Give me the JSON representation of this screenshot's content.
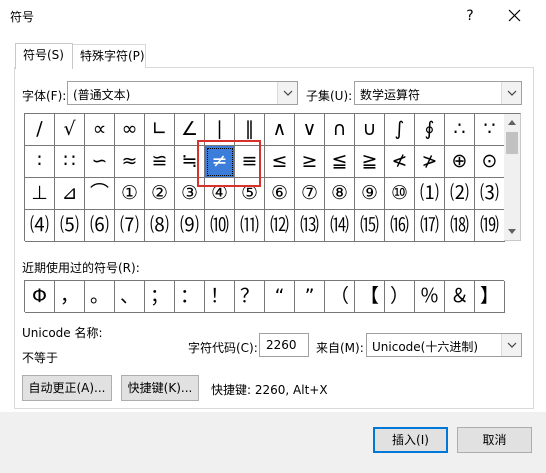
{
  "window": {
    "title": "符号",
    "help_label": "?"
  },
  "tabs": [
    {
      "label": "符号(S)",
      "active": true
    },
    {
      "label": "特殊字符(P)",
      "active": false
    }
  ],
  "font": {
    "label": "字体(F):",
    "value": "(普通文本)"
  },
  "subset": {
    "label": "子集(U):",
    "value": "数学运算符"
  },
  "symbol_rows": [
    [
      "∕",
      "√",
      "∝",
      "∞",
      "∟",
      "∠",
      "∣",
      "∥",
      "∧",
      "∨",
      "∩",
      "∪",
      "∫",
      "∮",
      "∴",
      "∵"
    ],
    [
      "∶",
      "∷",
      "∽",
      "≈",
      "≌",
      "≒",
      "≠",
      "≡",
      "≤",
      "≥",
      "≦",
      "≧",
      "≮",
      "≯",
      "⊕",
      "⊙"
    ],
    [
      "⊥",
      "⊿",
      "⌒",
      "①",
      "②",
      "③",
      "④",
      "⑤",
      "⑥",
      "⑦",
      "⑧",
      "⑨",
      "⑩",
      "⑴",
      "⑵",
      "⑶"
    ],
    [
      "⑷",
      "⑸",
      "⑹",
      "⑺",
      "⑻",
      "⑼",
      "⑽",
      "⑾",
      "⑿",
      "⒀",
      "⒁",
      "⒂",
      "⒃",
      "⒄",
      "⒅",
      "⒆"
    ]
  ],
  "selected": {
    "row": 1,
    "col": 6
  },
  "recent": {
    "label": "近期使用过的符号(R):",
    "symbols": [
      "Φ",
      "，",
      "。",
      "、",
      "；",
      "：",
      "！",
      "？",
      "“",
      "”",
      "（",
      "【",
      "）",
      "％",
      "＆",
      "】"
    ]
  },
  "unicode": {
    "name_label": "Unicode 名称:",
    "name_value": "不等于"
  },
  "char_code": {
    "label": "字符代码(C):",
    "value": "2260"
  },
  "from": {
    "label": "来自(M):",
    "value": "Unicode(十六进制)"
  },
  "buttons": {
    "autocorrect": "自动更正(A)...",
    "shortcut": "快捷键(K)...",
    "shortcut_info": "快捷键: 2260, Alt+X",
    "insert": "插入(I)",
    "cancel": "取消"
  },
  "colors": {
    "selection": "#3b7dd8",
    "highlight_box": "#d9322d",
    "default_button_border": "#0078d7"
  }
}
